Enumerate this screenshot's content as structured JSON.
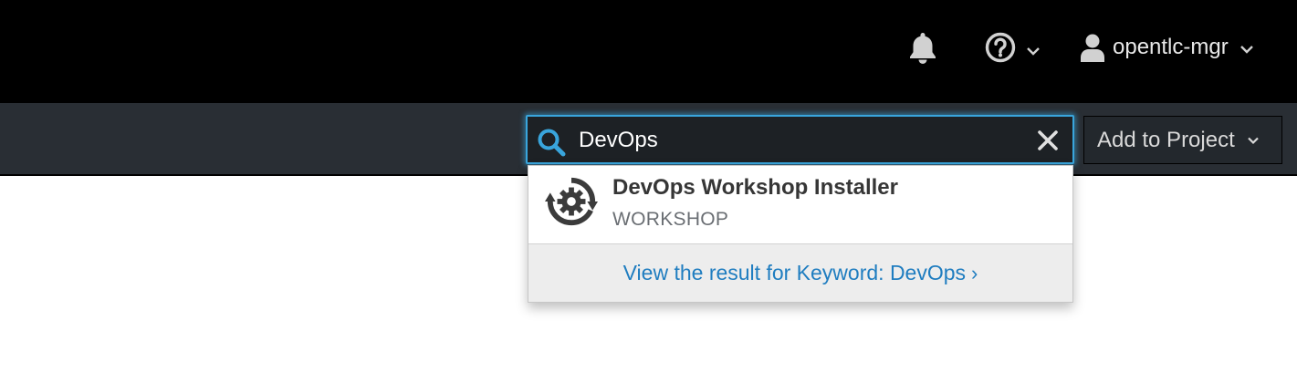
{
  "header": {
    "notifications_icon": "bell-icon",
    "help_icon": "question-circle-icon",
    "user_icon": "user-icon",
    "user_name": "opentlc-mgr"
  },
  "search": {
    "value": "DevOps",
    "icon": "search-icon",
    "clear_icon": "close-icon"
  },
  "toolbar": {
    "add_to_project_label": "Add to Project"
  },
  "results": {
    "items": [
      {
        "title": "DevOps Workshop Installer",
        "kind": "WORKSHOP",
        "icon": "gear-sync-icon"
      }
    ],
    "view_all_label": "View the result for Keyword: DevOps",
    "view_all_chevron": "›"
  },
  "colors": {
    "topbar": "#000000",
    "toolbar": "#292e34",
    "focus_border": "#39a5dc",
    "link": "#1f7dc0"
  }
}
